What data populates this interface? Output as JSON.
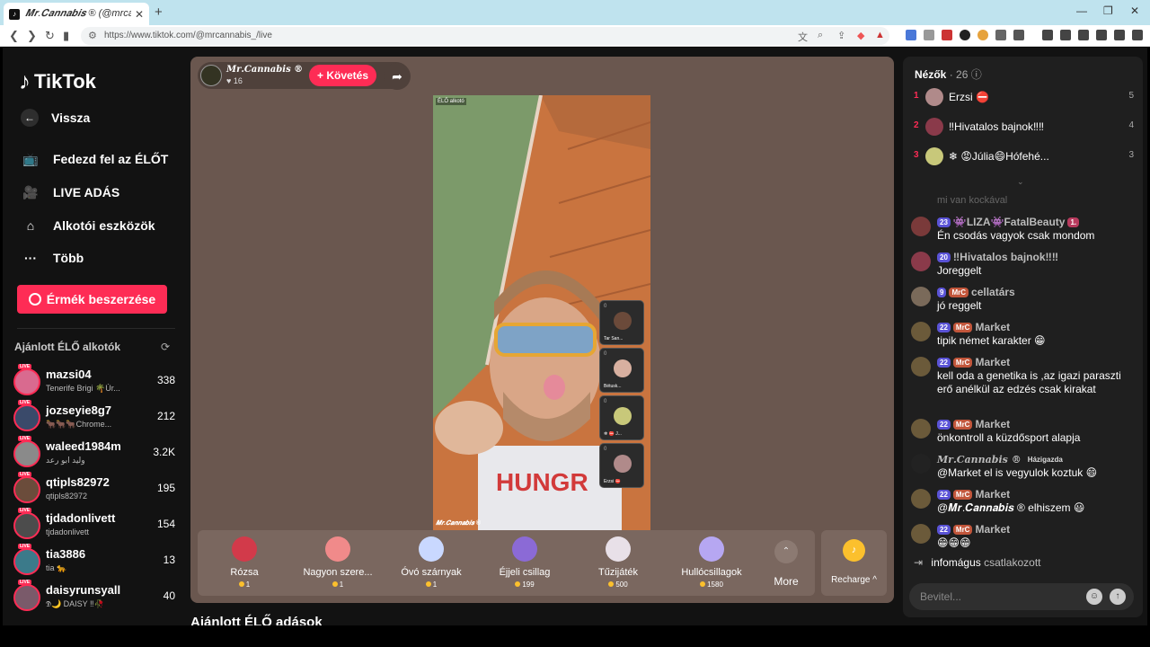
{
  "browser": {
    "tab_title": "𝑴𝒓.𝑪𝒂𝒏𝒏𝒂𝒃𝒊𝒔 ® (@mrcan",
    "url": "https://www.tiktok.com/@mrcannabis_/live"
  },
  "sidebar": {
    "logo": "TikTok",
    "back": "Vissza",
    "nav": [
      "Fedezd fel az ÉLŐT",
      "LIVE ADÁS",
      "Alkotói eszközök",
      "Több"
    ],
    "coins_button": "Érmék beszerzése",
    "recommended_title": "Ajánlott ÉLŐ alkotók",
    "live_badge": "LIVE",
    "creators": [
      {
        "name": "mazsi04",
        "sub": "Tenerife Brigi 🌴Úr...",
        "count": "338"
      },
      {
        "name": "jozseyie8g7",
        "sub": "🐂🐂🐂Chrome...",
        "count": "212"
      },
      {
        "name": "waleed1984m",
        "sub": "وليد ابو رعد",
        "count": "3.2K"
      },
      {
        "name": "qtipls82972",
        "sub": "qtipls82972",
        "count": "195"
      },
      {
        "name": "tjdadonlivett",
        "sub": "tjdadonlivett",
        "count": "154"
      },
      {
        "name": "tia3886",
        "sub": "tia 🐆",
        "count": "13"
      },
      {
        "name": "daisyrunsyall",
        "sub": "𝕯🌙 DAISY ‼🥀",
        "count": "40"
      }
    ]
  },
  "stream": {
    "host_name": "𝑴𝒓.𝑪𝒂𝒏𝒏𝒂𝒃𝒊𝒔 ®",
    "likes": "16",
    "follow": "+ Követés",
    "video_tag": "ÉLŐ alkotó",
    "video_watermark": "𝑴𝒓.𝑪𝒂𝒏𝒏𝒂𝒃𝒊𝒔 ®",
    "guests": [
      {
        "score": "0",
        "name": "Tar San..."
      },
      {
        "score": "0",
        "name": "Bétusk..."
      },
      {
        "score": "0",
        "name": "❄ ⛔ J..."
      },
      {
        "score": "0",
        "name": "Erzsi ⛔"
      }
    ],
    "gifts": [
      {
        "name": "Rózsa",
        "price": "1",
        "color": "#d23a4a"
      },
      {
        "name": "Nagyon szere...",
        "price": "1",
        "color": "#f08a8a"
      },
      {
        "name": "Óvó szárnyak",
        "price": "1",
        "color": "#c9d8ff"
      },
      {
        "name": "Éjjeli csillag",
        "price": "199",
        "color": "#8b6ad6"
      },
      {
        "name": "Tűzijáték",
        "price": "500",
        "color": "#e8e0e8"
      },
      {
        "name": "Hullócsillagok",
        "price": "1580",
        "color": "#b6a7f2"
      }
    ],
    "more": "More",
    "recharge": "Recharge ^",
    "recommended_live": "Ajánlott ÉLŐ adások"
  },
  "viewers": {
    "title": "Nézők",
    "count": "26",
    "top": [
      {
        "rank": "1",
        "name": "Erzsi ⛔",
        "score": "5"
      },
      {
        "rank": "2",
        "name": "‼Hivatalos bajnok‼‼",
        "score": "4"
      },
      {
        "rank": "3",
        "name": "❄ 😡Júlia😄Hófehé...",
        "score": "3"
      }
    ]
  },
  "chat": {
    "faded": "mi van kockával",
    "messages": [
      {
        "badges": [
          "23",
          "",
          "1."
        ],
        "name": "👾LIZA👾FatalBeauty",
        "text": "Én csodás vagyok csak mondom"
      },
      {
        "badges": [
          "20"
        ],
        "name": "‼Hivatalos bajnok‼‼",
        "text": "Joreggelt"
      },
      {
        "badges": [
          "9",
          "MrC"
        ],
        "name": "cellatárs",
        "text": "jó reggelt"
      },
      {
        "badges": [
          "22",
          "MrC"
        ],
        "name": "Market",
        "text": "tipik német karakter 😁"
      },
      {
        "badges": [
          "22",
          "MrC"
        ],
        "name": "Market",
        "text": "kell oda a genetika is ,az igazi paraszti erő anélkül az edzés csak kirakat"
      },
      {
        "badges": [
          "22",
          "MrC"
        ],
        "name": "Market",
        "text": "önkontroll a küzdősport alapja"
      },
      {
        "badges": [
          "Házigazda"
        ],
        "name": "𝑴𝒓.𝑪𝒂𝒏𝒏𝒂𝒃𝒊𝒔 ®",
        "text": "@Market el is vegyulok koztuk 😄"
      },
      {
        "badges": [
          "22",
          "MrC"
        ],
        "name": "Market",
        "text": "@𝑴𝒓.𝑪𝒂𝒏𝒏𝒂𝒃𝒊𝒔 ® elhiszem 😃"
      },
      {
        "badges": [
          "22",
          "MrC"
        ],
        "name": "Market",
        "text": "😁😁😁"
      }
    ],
    "join_user": "infomágus",
    "join_text": "csatlakozott",
    "input_placeholder": "Bevitel..."
  }
}
